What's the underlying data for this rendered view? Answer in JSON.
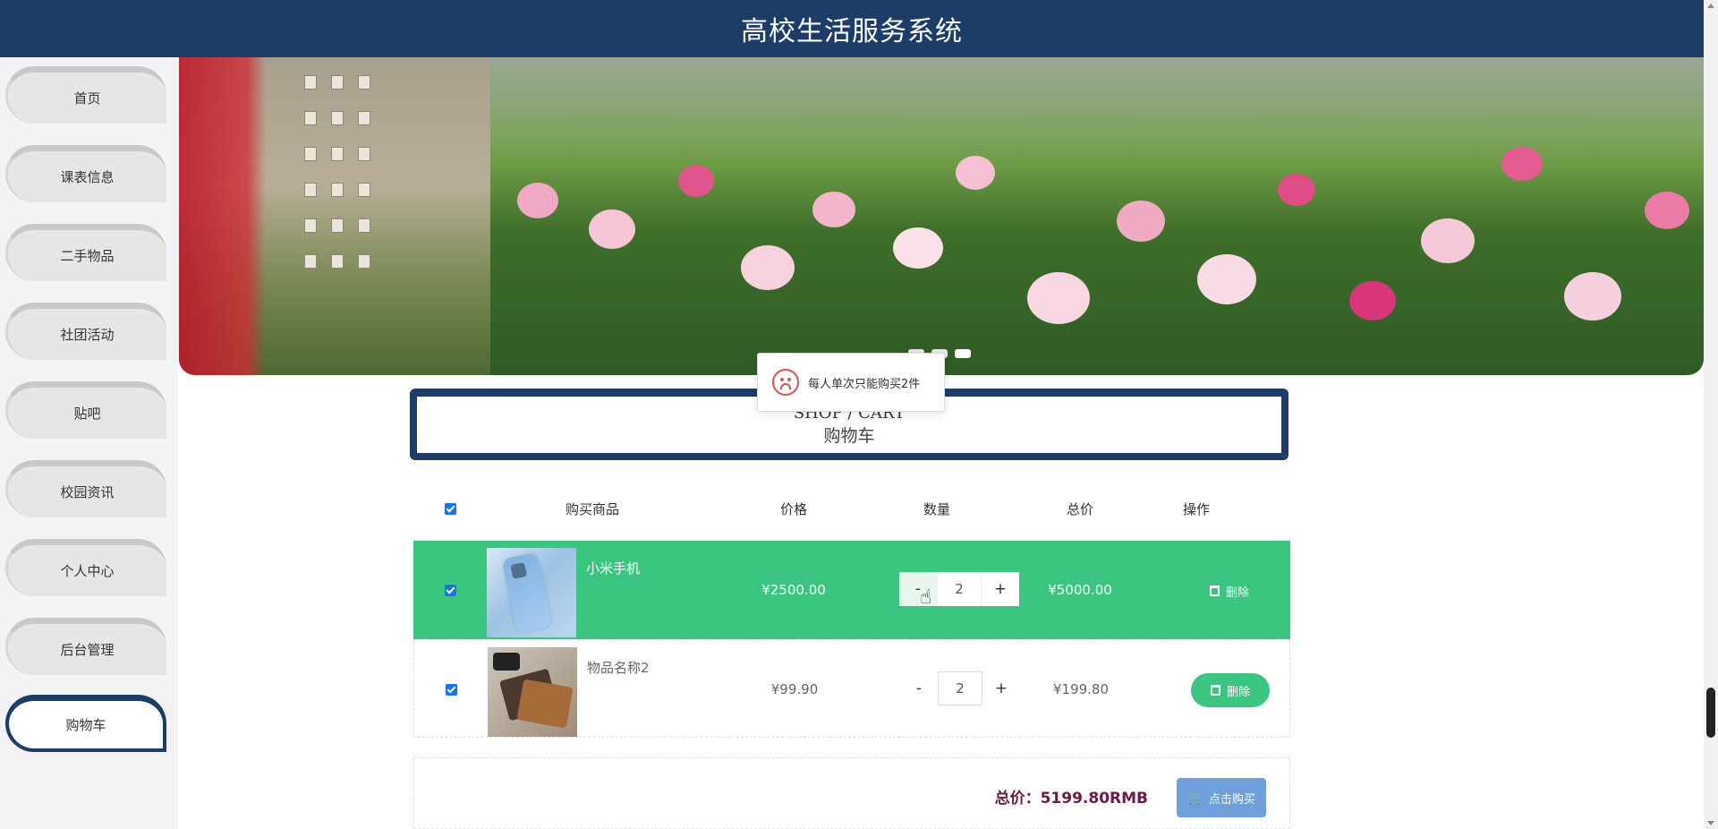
{
  "header": {
    "title": "高校生活服务系统"
  },
  "sidebar": {
    "items": [
      {
        "label": "首页"
      },
      {
        "label": "课表信息"
      },
      {
        "label": "二手物品"
      },
      {
        "label": "社团活动"
      },
      {
        "label": "贴吧"
      },
      {
        "label": "校园资讯"
      },
      {
        "label": "个人中心"
      },
      {
        "label": "后台管理"
      },
      {
        "label": "购物车",
        "active": true
      }
    ]
  },
  "banner": {
    "dots": 3,
    "active_dot": 2
  },
  "toast": {
    "message": "每人单次只能购买2件"
  },
  "cart": {
    "title_en": "SHOP / CART",
    "title_cn": "购物车",
    "columns": [
      "购买商品",
      "价格",
      "数量",
      "总价",
      "操作"
    ],
    "select_all_checked": true,
    "rows": [
      {
        "checked": true,
        "name": "小米手机",
        "price": "¥2500.00",
        "qty": "2",
        "minus": "-",
        "plus": "+",
        "total": "¥5000.00",
        "delete": "删除",
        "selected": true
      },
      {
        "checked": true,
        "name": "物品名称2",
        "price": "¥99.90",
        "qty": "2",
        "minus": "-",
        "plus": "+",
        "total": "¥199.80",
        "delete": "删除",
        "selected": false
      }
    ],
    "total_text": "总价：5199.80RMB",
    "buy_label": "点击购买"
  },
  "colors": {
    "header": "#1d3c67",
    "accent_green": "#3cc581",
    "buy_button": "#6fa0db",
    "total_text": "#6b1a4a"
  },
  "icons": [
    "sad-face-icon",
    "trash-icon",
    "cart-icon",
    "hand-cursor-icon"
  ]
}
